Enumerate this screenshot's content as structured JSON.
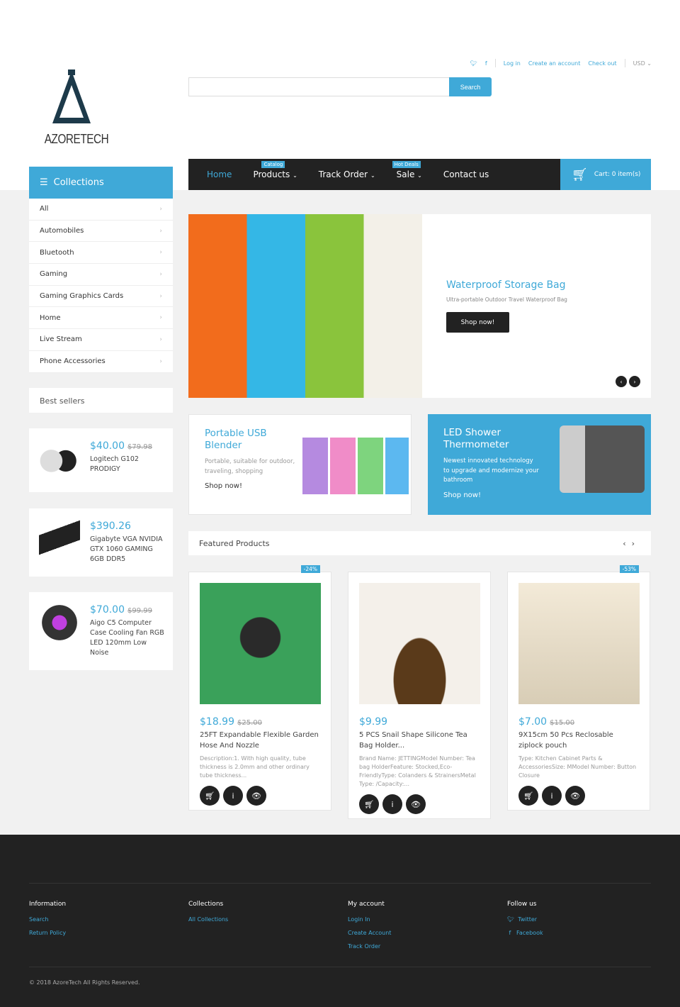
{
  "header": {
    "brand": "AZORETECH",
    "top_links": [
      "Log in",
      "Create an account",
      "Check out"
    ],
    "currency": "USD",
    "search_placeholder": "",
    "search_button": "Search",
    "cart": "Cart: 0 item(s)"
  },
  "nav": [
    {
      "label": "Home",
      "badge": ""
    },
    {
      "label": "Products",
      "badge": "Catalog"
    },
    {
      "label": "Track Order",
      "badge": ""
    },
    {
      "label": "Sale",
      "badge": "Hot Deals"
    },
    {
      "label": "Contact us",
      "badge": ""
    }
  ],
  "sidebar": {
    "title": "Collections",
    "items": [
      "All",
      "Automobiles",
      "Bluetooth",
      "Gaming",
      "Gaming Graphics Cards",
      "Home",
      "Live Stream",
      "Phone Accessories"
    ],
    "best_sellers_title": "Best sellers",
    "best_sellers": [
      {
        "price": "$40.00",
        "old": "$79.98",
        "name": "Logitech G102 PRODIGY"
      },
      {
        "price": "$390.26",
        "old": "",
        "name": "Gigabyte VGA NVIDIA GTX 1060 GAMING 6GB DDR5"
      },
      {
        "price": "$70.00",
        "old": "$99.99",
        "name": "Aigo C5 Computer Case Cooling Fan RGB LED 120mm Low Noise"
      }
    ]
  },
  "slider": {
    "title": "Waterproof Storage Bag",
    "subtitle": "Ultra-portable Outdoor Travel Waterproof Bag",
    "button": "Shop now!"
  },
  "promos": [
    {
      "title": "Portable USB Blender",
      "text": "Portable, suitable for outdoor, traveling, shopping",
      "button": "Shop now!"
    },
    {
      "title": "LED Shower Thermometer",
      "text": "Newest innovated technology to upgrade and modernize your bathroom",
      "button": "Shop now!"
    }
  ],
  "featured": {
    "title": "Featured Products",
    "products": [
      {
        "discount": "-24%",
        "price": "$18.99",
        "old": "$25.00",
        "name": "25FT Expandable Flexible Garden Hose And Nozzle",
        "desc": "Description:1. With high quality, tube thickness is 2.0mm and other ordinary tube thickness..."
      },
      {
        "discount": "",
        "price": "$9.99",
        "old": "",
        "name": "5 PCS Snail Shape Silicone Tea Bag Holder...",
        "desc": "Brand Name: JETTINGModel Number: Tea bag HolderFeature: Stocked,Eco-FriendlyType: Colanders & StrainersMetal Type: /Capacity:..."
      },
      {
        "discount": "-53%",
        "price": "$7.00",
        "old": "$15.00",
        "name": "9X15cm 50 Pcs Reclosable ziplock pouch",
        "desc": "Type: Kitchen Cabinet Parts & AccessoriesSize: MModel Number: Button Closure"
      }
    ]
  },
  "footer": {
    "columns": [
      {
        "title": "Information",
        "links": [
          "Search",
          "Return Policy"
        ]
      },
      {
        "title": "Collections",
        "links": [
          "All Collections"
        ]
      },
      {
        "title": "My account",
        "links": [
          "Login In",
          "Create Account",
          "Track Order"
        ]
      },
      {
        "title": "Follow us",
        "links": [
          "Twitter",
          "Facebook"
        ]
      }
    ],
    "copyright": "© 2018 AzoreTech All Rights Reserved."
  },
  "colors": {
    "accent": "#3fa9d8",
    "dark": "#222222"
  }
}
